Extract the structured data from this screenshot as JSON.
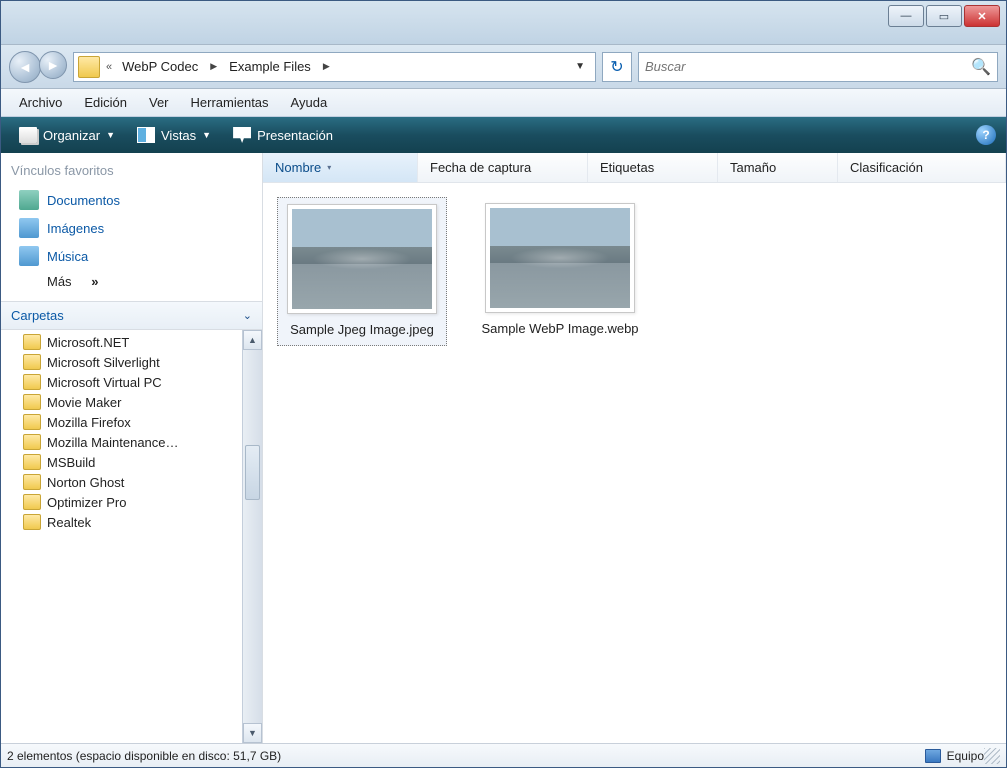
{
  "titlebar": {
    "minimize": "—",
    "maximize": "▭",
    "close": "✕"
  },
  "nav": {
    "breadcrumb": {
      "prefix": "«",
      "items": [
        "WebP Codec",
        "Example Files"
      ]
    },
    "search_placeholder": "Buscar"
  },
  "menubar": [
    "Archivo",
    "Edición",
    "Ver",
    "Herramientas",
    "Ayuda"
  ],
  "cmdbar": {
    "organize": "Organizar",
    "views": "Vistas",
    "presentation": "Presentación"
  },
  "sidebar": {
    "favorites_header": "Vínculos favoritos",
    "favorites": [
      {
        "label": "Documentos",
        "icon": "doc"
      },
      {
        "label": "Imágenes",
        "icon": "img"
      },
      {
        "label": "Música",
        "icon": "mus"
      }
    ],
    "more": "Más",
    "folders_header": "Carpetas",
    "folders": [
      "Microsoft.NET",
      "Microsoft Silverlight",
      "Microsoft Virtual PC",
      "Movie Maker",
      "Mozilla Firefox",
      "Mozilla Maintenance…",
      "MSBuild",
      "Norton Ghost",
      "Optimizer Pro",
      "Realtek"
    ]
  },
  "columns": [
    "Nombre",
    "Fecha de captura",
    "Etiquetas",
    "Tamaño",
    "Clasificación"
  ],
  "files": [
    {
      "name": "Sample Jpeg Image.jpeg",
      "selected": true
    },
    {
      "name": "Sample WebP Image.webp",
      "selected": false
    }
  ],
  "statusbar": {
    "left": "2 elementos (espacio disponible en disco: 51,7 GB)",
    "right": "Equipo"
  }
}
